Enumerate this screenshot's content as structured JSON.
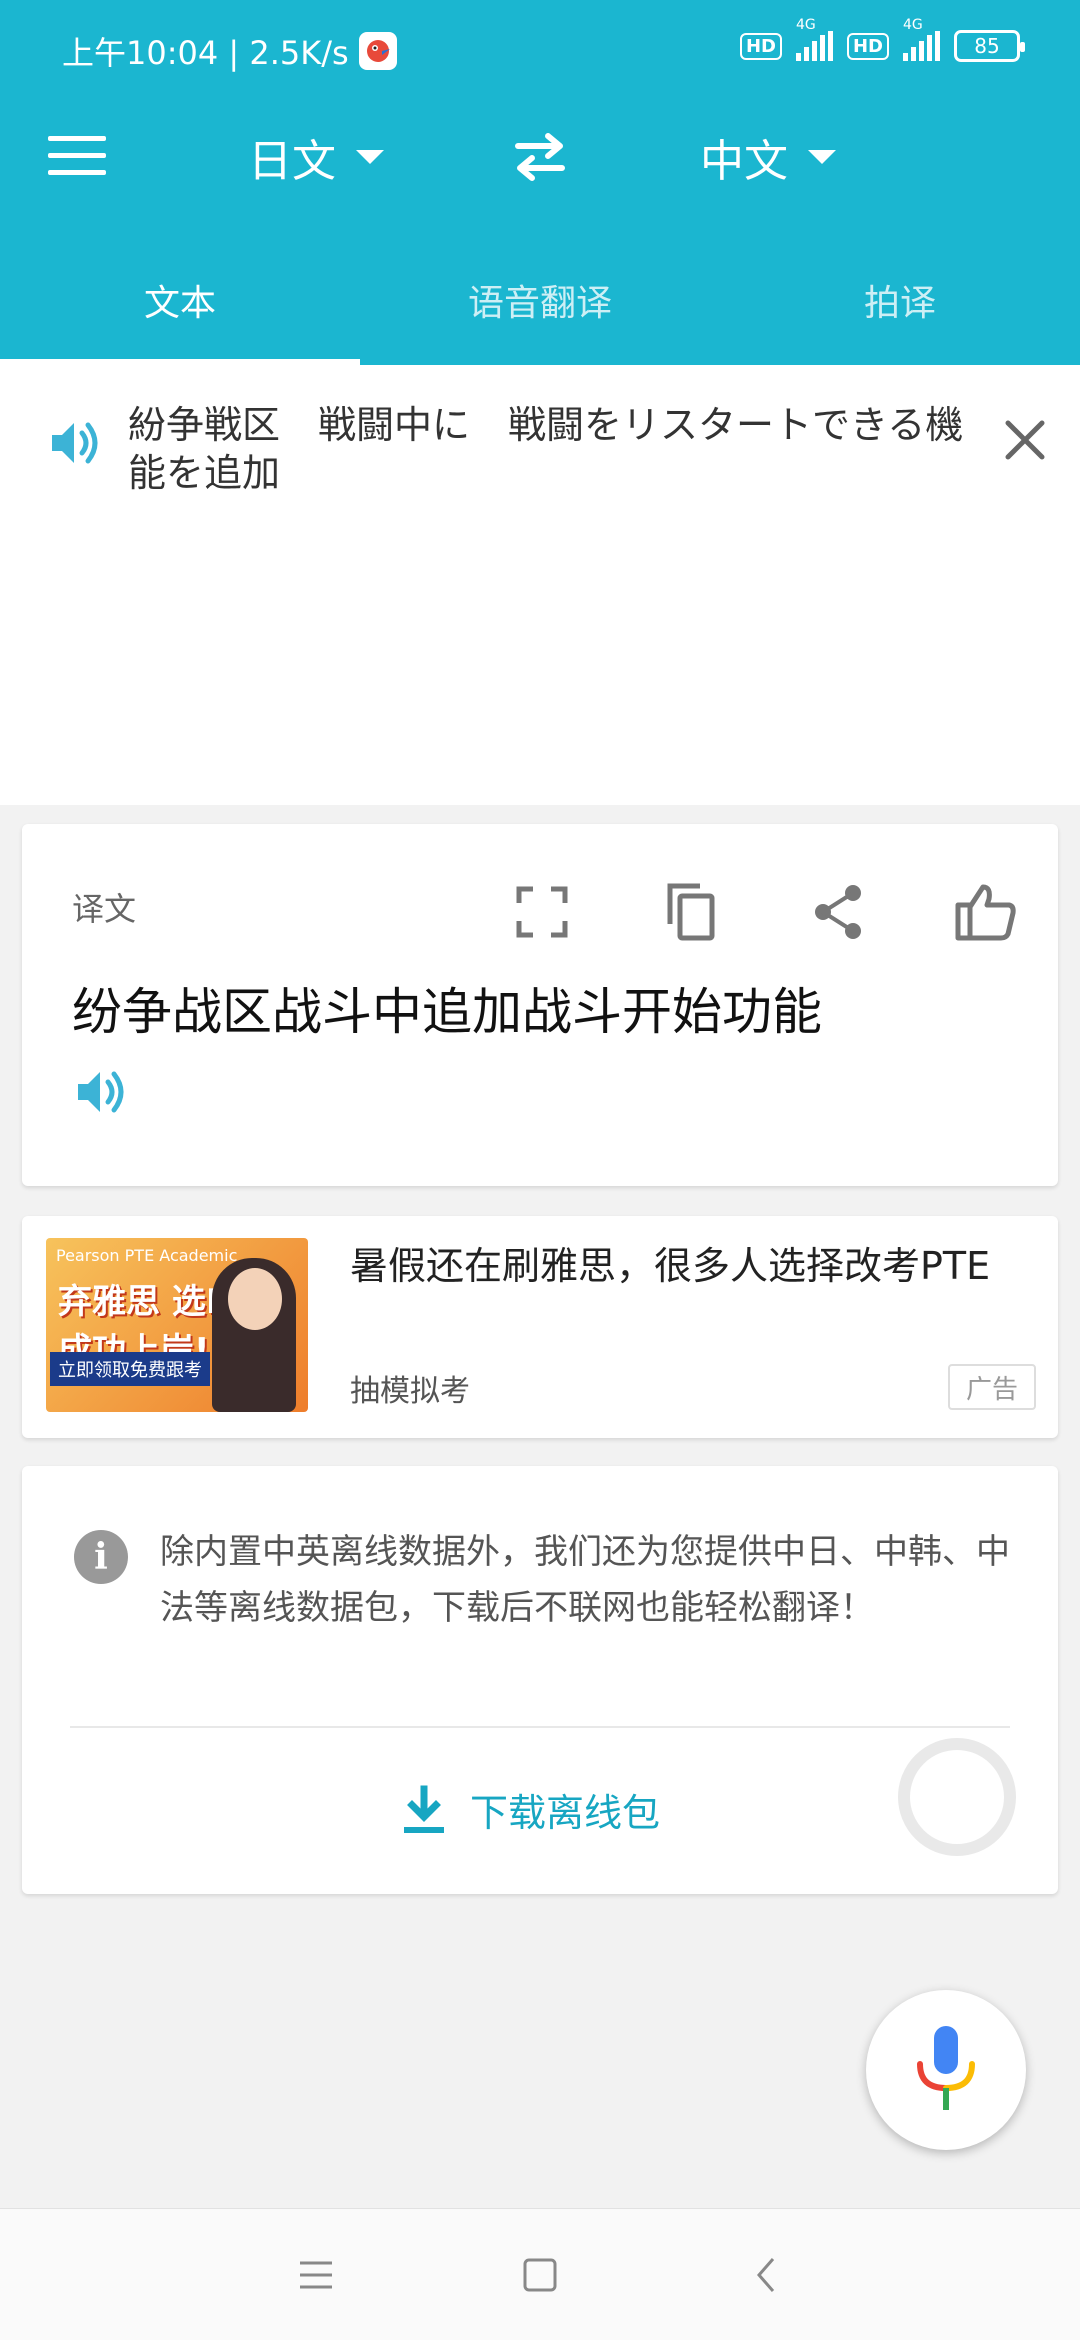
{
  "statusbar": {
    "time_speed": "上午10:04 | 2.5K/s",
    "hd1": "HD",
    "hd2": "HD",
    "net1": "4G",
    "net2": "4G",
    "battery": "85"
  },
  "toolbar": {
    "source_lang": "日文",
    "target_lang": "中文"
  },
  "tabs": [
    {
      "label": "文本",
      "active": true
    },
    {
      "label": "语音翻译",
      "active": false
    },
    {
      "label": "拍译",
      "active": false
    }
  ],
  "input": {
    "source_text": "紛争戦区　戦闘中に　戦闘をリスタートできる機能を追加"
  },
  "translation": {
    "label": "译文",
    "text": "纷争战区战斗中追加战斗开始功能"
  },
  "ad": {
    "image_top_text": "Pearson PTE Academic",
    "image_title": "弃雅思 选PTE 成功上岸!",
    "image_sub": "立即领取免费跟考",
    "title": "暑假还在刷雅思，很多人选择改考PTE",
    "source": "抽模拟考",
    "badge": "广告"
  },
  "offline": {
    "info_icon": "i",
    "text": "除内置中英离线数据外，我们还为您提供中日、中韩、中法等离线数据包，下载后不联网也能轻松翻译！",
    "download_label": "下载离线包"
  },
  "colors": {
    "primary": "#1bb6d0",
    "accent_text": "#17a6c2"
  }
}
